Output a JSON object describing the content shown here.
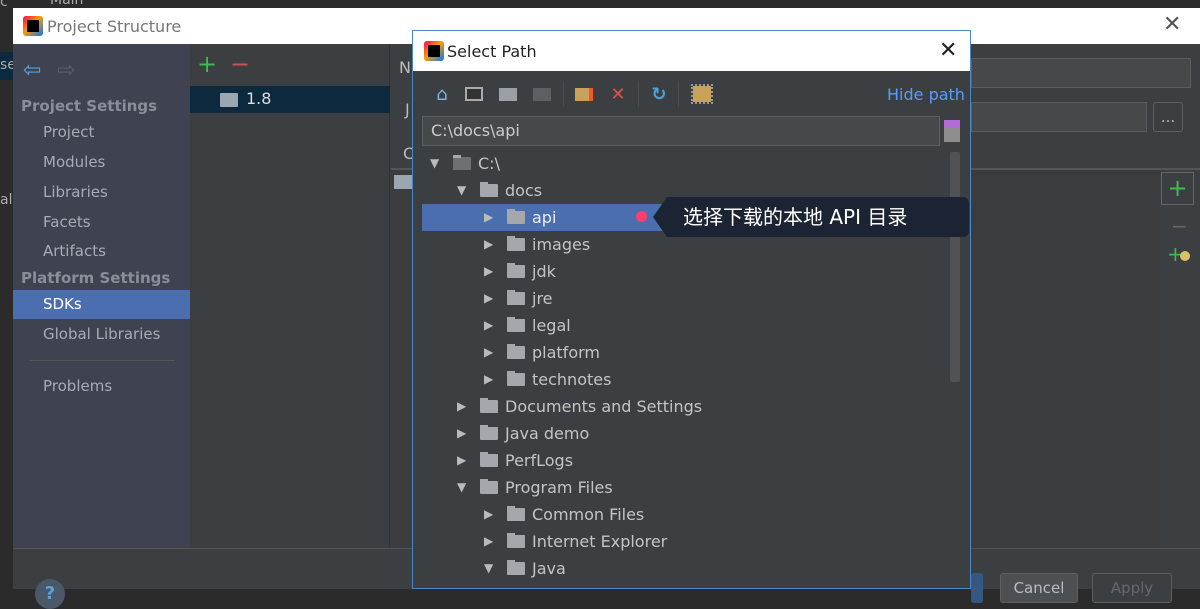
{
  "background_window": {
    "fragments": [
      "c",
      "Main",
      "se",
      "al"
    ]
  },
  "project_structure": {
    "title": "Project Structure",
    "sidebar": {
      "project_settings_header": "Project Settings",
      "project_items": [
        "Project",
        "Modules",
        "Libraries",
        "Facets",
        "Artifacts"
      ],
      "platform_settings_header": "Platform Settings",
      "platform_items": [
        "SDKs",
        "Global Libraries"
      ],
      "selected": "SDKs",
      "problems": "Problems"
    },
    "sdk_list": [
      "1.8"
    ],
    "right_labels": {
      "name_initial": "N",
      "jdk_initial": "J",
      "tab_initial": "C"
    },
    "browse_label": "...",
    "buttons": {
      "help": "?",
      "cancel": "Cancel",
      "apply": "Apply"
    }
  },
  "select_path": {
    "title": "Select Path",
    "hide_path": "Hide path",
    "path_value": "C:\\docs\\api",
    "toolbar_icons": [
      "home-icon",
      "desktop-icon",
      "new-folder-icon",
      "collapse-icon",
      "folder-star-icon",
      "delete-icon",
      "refresh-icon",
      "show-hidden-icon"
    ],
    "tree": [
      {
        "label": "C:\\",
        "level": 0,
        "expanded": true
      },
      {
        "label": "docs",
        "level": 1,
        "expanded": true
      },
      {
        "label": "api",
        "level": 2,
        "expanded": false,
        "selected": true
      },
      {
        "label": "images",
        "level": 2,
        "expanded": false
      },
      {
        "label": "jdk",
        "level": 2,
        "expanded": false
      },
      {
        "label": "jre",
        "level": 2,
        "expanded": false
      },
      {
        "label": "legal",
        "level": 2,
        "expanded": false
      },
      {
        "label": "platform",
        "level": 2,
        "expanded": false
      },
      {
        "label": "technotes",
        "level": 2,
        "expanded": false
      },
      {
        "label": "Documents and Settings",
        "level": 1,
        "expanded": false
      },
      {
        "label": "Java demo",
        "level": 1,
        "expanded": false
      },
      {
        "label": "PerfLogs",
        "level": 1,
        "expanded": false
      },
      {
        "label": "Program Files",
        "level": 1,
        "expanded": true
      },
      {
        "label": "Common Files",
        "level": 2,
        "expanded": false
      },
      {
        "label": "Internet Explorer",
        "level": 2,
        "expanded": false
      },
      {
        "label": "Java",
        "level": 2,
        "expanded": true
      }
    ]
  },
  "annotation": {
    "text": "选择下载的本地 API 目录",
    "dot_color": "#ff3d6e"
  },
  "colors": {
    "selection": "#4b6eaf",
    "link": "#589df6",
    "add": "#3fb950",
    "remove": "#c75450"
  }
}
